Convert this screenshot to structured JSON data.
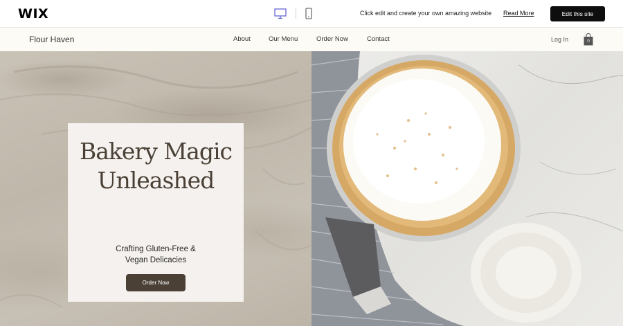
{
  "wix_bar": {
    "logo": "WIX",
    "message": "Click edit and create your own amazing website",
    "read_more": "Read More",
    "edit_button": "Edit this site"
  },
  "site": {
    "title": "Flour Haven",
    "nav": [
      "About",
      "Our Menu",
      "Order Now",
      "Contact"
    ],
    "login": "Log In",
    "cart_count": "0"
  },
  "hero": {
    "title_line1": "Bakery Magic",
    "title_line2": "Unleashed",
    "subtitle_line1": "Crafting Gluten-Free &",
    "subtitle_line2": "Vegan Delicacies",
    "button": "Order Now"
  },
  "icons": {
    "desktop": "desktop-icon",
    "mobile": "mobile-icon",
    "cart": "shopping-bag-icon"
  },
  "colors": {
    "accent": "#4a4036",
    "edit_button_bg": "#0e0e0e",
    "header_bg": "#fcfbf6",
    "card_bg": "#f4f1ee",
    "device_icon": "#5b5bd6"
  }
}
